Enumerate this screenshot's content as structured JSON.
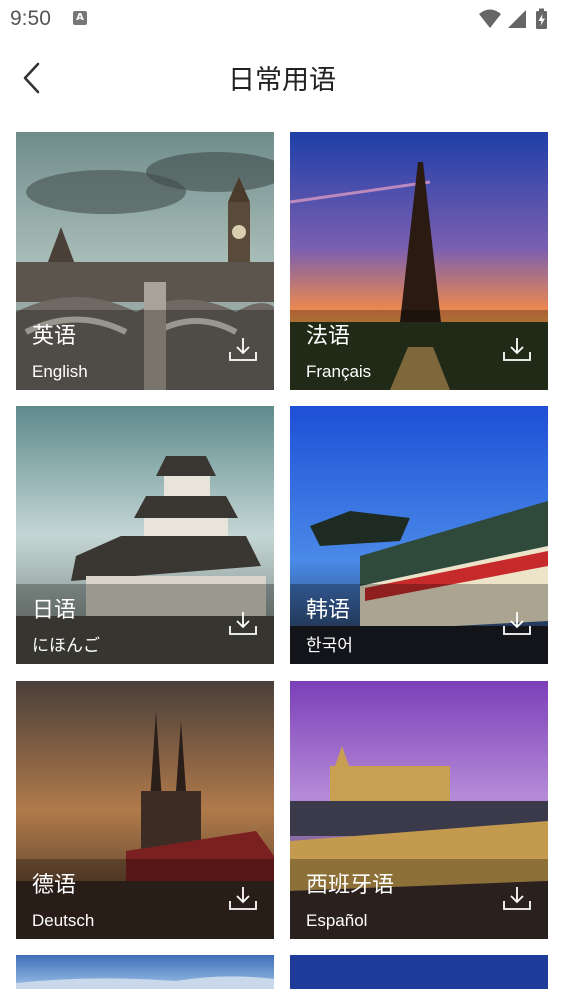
{
  "status": {
    "time": "9:50",
    "a_icon": "A",
    "icons": [
      "wifi-icon",
      "signal-icon",
      "battery-charging-icon"
    ]
  },
  "header": {
    "title": "日常用语",
    "back_icon": "chevron-left-icon"
  },
  "cards": [
    {
      "name": "english",
      "cn": "英语",
      "native": "English"
    },
    {
      "name": "french",
      "cn": "法语",
      "native": "Français"
    },
    {
      "name": "japanese",
      "cn": "日语",
      "native": "にほんご"
    },
    {
      "name": "korean",
      "cn": "韩语",
      "native": "한국어"
    },
    {
      "name": "german",
      "cn": "德语",
      "native": "Deutsch"
    },
    {
      "name": "spanish",
      "cn": "西班牙语",
      "native": "Español"
    }
  ],
  "download_icon": "download-icon"
}
